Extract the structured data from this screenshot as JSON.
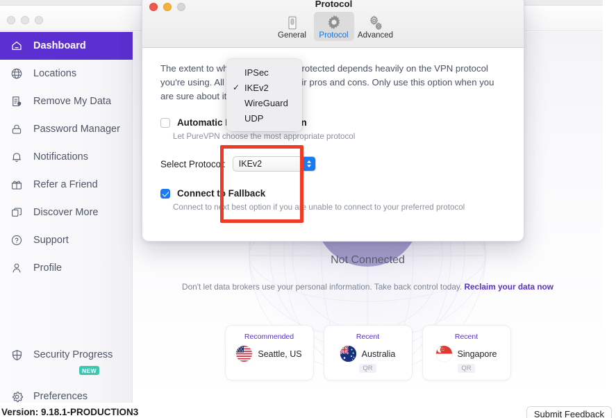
{
  "app": {
    "version_text": "Version: 9.18.1-PRODUCTION3",
    "submit_feedback_label": "Submit Feedback"
  },
  "sidebar": {
    "items": [
      {
        "label": "Dashboard",
        "icon": "home-icon",
        "active": true
      },
      {
        "label": "Locations",
        "icon": "globe-icon",
        "active": false
      },
      {
        "label": "Remove My Data",
        "icon": "document-shield-icon",
        "active": false
      },
      {
        "label": "Password Manager",
        "icon": "lock-icon",
        "active": false
      },
      {
        "label": "Notifications",
        "icon": "bell-icon",
        "active": false
      },
      {
        "label": "Refer a Friend",
        "icon": "gift-icon",
        "active": false
      },
      {
        "label": "Discover More",
        "icon": "copy-icon",
        "active": false
      },
      {
        "label": "Support",
        "icon": "question-circle-icon",
        "active": false
      },
      {
        "label": "Profile",
        "icon": "person-icon",
        "active": false
      }
    ],
    "bottom_items": [
      {
        "label": "Security Progress",
        "icon": "shield-icon",
        "badge": "NEW"
      },
      {
        "label": "Preferences",
        "icon": "gear-icon",
        "badge": ""
      }
    ],
    "active_color": "#5b2fd0",
    "badge_color": "#3fc6b0"
  },
  "main": {
    "status": "Not Connected",
    "promo_text": "Don't let data brokers use your personal information. Take back control today. ",
    "promo_link": "Reclaim your data now",
    "cards": [
      {
        "tag": "Recommended",
        "city": "Seattle, US",
        "qr": "",
        "flag": "us-flag-icon"
      },
      {
        "tag": "Recent",
        "city": "Australia",
        "qr": "QR",
        "flag": "au-flag-icon"
      },
      {
        "tag": "Recent",
        "city": "Singapore",
        "qr": "QR",
        "flag": "sg-flag-icon"
      }
    ]
  },
  "modal": {
    "title": "Protocol",
    "tabs": [
      {
        "label": "General",
        "icon": "switch-icon",
        "selected": false
      },
      {
        "label": "Protocol",
        "icon": "gear-icon",
        "selected": true
      },
      {
        "label": "Advanced",
        "icon": "gears-icon",
        "selected": false
      }
    ],
    "description": "The extent to which your traffic is protected depends heavily on the VPN protocol you're using. All protocols have their pros and cons. Only use this option when you are sure about it.",
    "auto_protocol": {
      "label": "Automatic Protocol Selection",
      "sublabel": "Let PureVPN choose the most appropriate protocol",
      "checked": false
    },
    "select_protocol": {
      "label": "Select Protocol:",
      "value": "IKEv2"
    },
    "connect_fallback": {
      "label": "Connect to Fallback",
      "sublabel": "Connect to next best option if you are unable to connect to your preferred protocol",
      "checked": true
    },
    "popup_menu": {
      "options": [
        {
          "label": "IPSec",
          "checked": false
        },
        {
          "label": "IKEv2",
          "checked": true
        },
        {
          "label": "WireGuard",
          "checked": false
        },
        {
          "label": "UDP",
          "checked": false
        }
      ],
      "checkmark": "✓"
    },
    "accent_blue": "#1a7bf0",
    "highlight_color": "#ef3b24"
  }
}
